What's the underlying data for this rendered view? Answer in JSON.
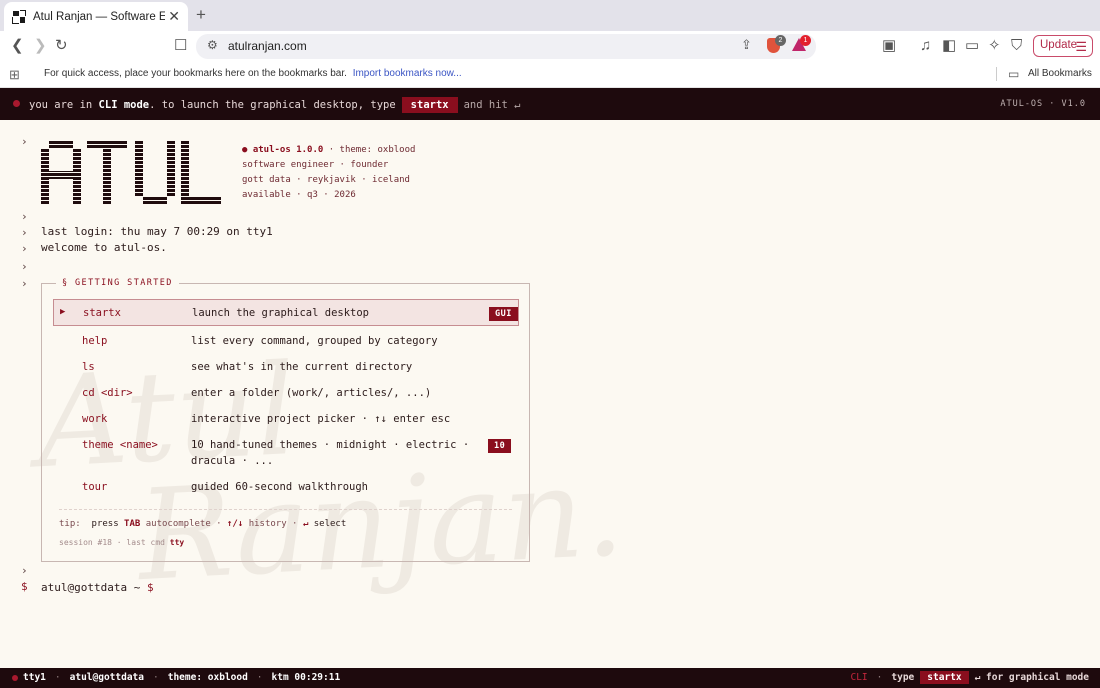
{
  "browser": {
    "tab_title": "Atul Ranjan — Software Engineer",
    "url": "atulranjan.com",
    "shield_count": "2",
    "rewards_count": "1",
    "update_label": "Update",
    "bookmarks_prompt": "For quick access, place your bookmarks here on the bookmarks bar.",
    "import_bookmarks": "Import bookmarks now...",
    "all_bookmarks": "All Bookmarks"
  },
  "cli_bar": {
    "prefix": "you are in",
    "mode": "CLI mode",
    "middle": ". to launch the graphical desktop, type",
    "command": "startx",
    "suffix": "and hit ↵",
    "version": "ATUL-OS · V1.0"
  },
  "logo": {
    "text": "ATUL"
  },
  "sysinfo": {
    "name": "atul-os 1.0.0",
    "theme": "· theme: oxblood",
    "line2": "software engineer · founder",
    "line3": "gott data · reykjavik · iceland",
    "line4": "available · q3 · 2026"
  },
  "terminal": {
    "last_login": "last login: thu may 7 00:29 on tty1",
    "welcome": "welcome to atul-os."
  },
  "getting_started": {
    "title": "§ GETTING STARTED",
    "rows": [
      {
        "cmd": "startx",
        "desc": "launch the graphical desktop",
        "badge": "GUI"
      },
      {
        "cmd": "help",
        "desc": "list every command, grouped by category"
      },
      {
        "cmd": "ls",
        "desc": "see what's in the current directory"
      },
      {
        "cmd": "cd <dir>",
        "desc": "enter a folder (work/, articles/, ...)"
      },
      {
        "cmd": "work",
        "desc": "interactive project picker · ↑↓ enter esc"
      },
      {
        "cmd": "theme <name>",
        "desc": "10 hand-tuned themes · midnight · electric ·",
        "desc2": "dracula · ...",
        "badge": "10"
      },
      {
        "cmd": "tour",
        "desc": "guided 60-second walkthrough"
      }
    ],
    "tip_label": "tip:",
    "tip_press": "press",
    "tip_tab": "TAB",
    "tip_autocomplete": "autocomplete ·",
    "tip_arrows": "↑/↓",
    "tip_history": "history ·",
    "tip_enter": "↵",
    "tip_select": "select",
    "session_text": "session #18 · last cmd",
    "session_cmd": "tty"
  },
  "prompt": {
    "marker": "$",
    "user": "atul@gottdata ~",
    "symbol": "$"
  },
  "watermark": {
    "line1": "Atul",
    "line2": "Ranjan."
  },
  "statusbar": {
    "tty": "tty1",
    "user": "atul@gottdata",
    "theme": "theme: oxblood",
    "clock": "ktm 00:29:11",
    "mode": "CLI",
    "type": "type",
    "command": "startx",
    "hint": "↵ for graphical mode"
  },
  "colors": {
    "accent": "#8a0e1e",
    "background": "#fcf9f2",
    "bar": "#1e0a0d"
  }
}
